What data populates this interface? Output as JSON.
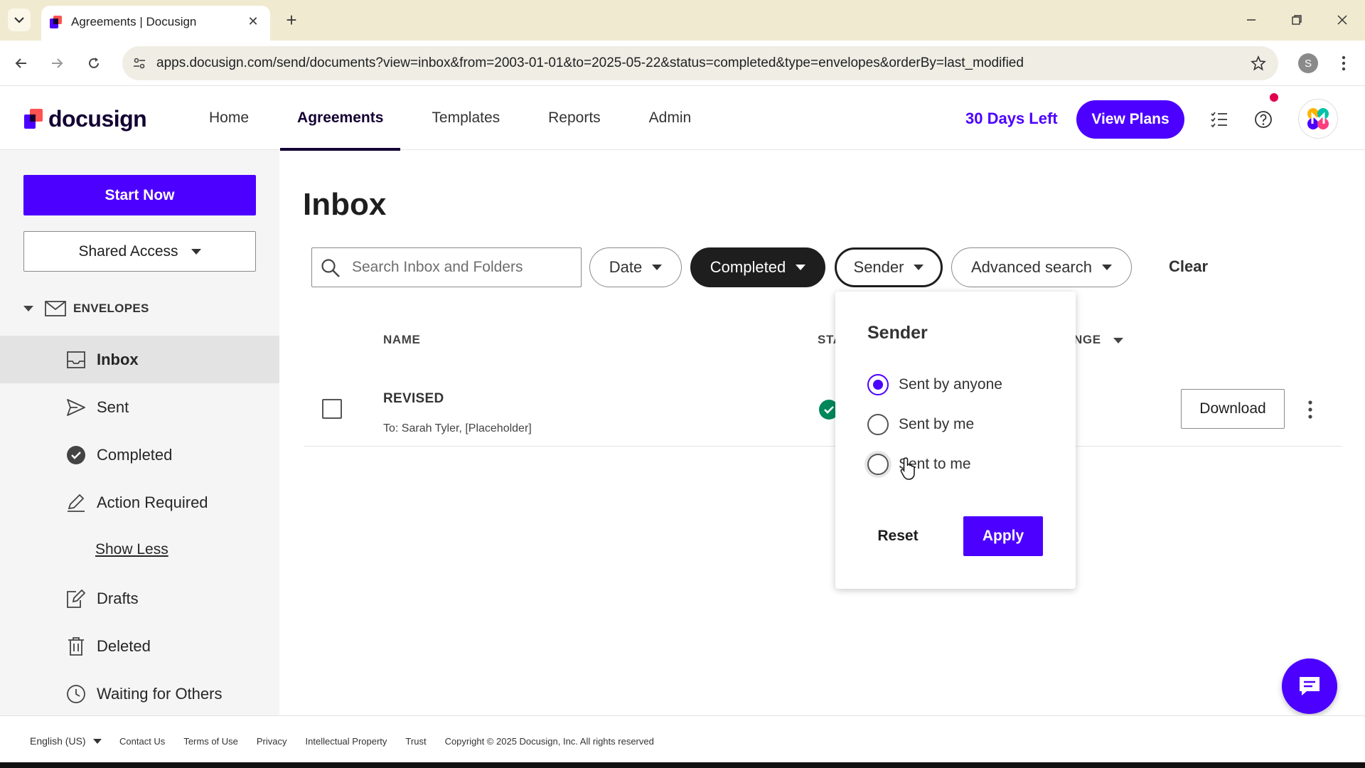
{
  "browser": {
    "tab_title": "Agreements | Docusign",
    "url": "apps.docusign.com/send/documents?view=inbox&from=2003-01-01&to=2025-05-22&status=completed&type=envelopes&orderBy=last_modified",
    "profile_initial": "S"
  },
  "header": {
    "logo_text": "docusign",
    "nav": [
      {
        "label": "Home"
      },
      {
        "label": "Agreements",
        "active": true
      },
      {
        "label": "Templates"
      },
      {
        "label": "Reports"
      },
      {
        "label": "Admin"
      }
    ],
    "trial": "30 Days Left",
    "view_plans": "View Plans"
  },
  "sidebar": {
    "start_now": "Start Now",
    "shared_access": "Shared Access",
    "envelopes_label": "ENVELOPES",
    "items": [
      {
        "label": "Inbox",
        "icon": "inbox-icon",
        "active": true
      },
      {
        "label": "Sent",
        "icon": "send-icon"
      },
      {
        "label": "Completed",
        "icon": "check-circle-icon"
      },
      {
        "label": "Action Required",
        "icon": "pen-icon"
      },
      {
        "label": "Drafts",
        "icon": "draft-icon"
      },
      {
        "label": "Deleted",
        "icon": "trash-icon"
      },
      {
        "label": "Waiting for Others",
        "icon": "clock-icon"
      }
    ],
    "show_less": "Show Less"
  },
  "main": {
    "title": "Inbox",
    "search_placeholder": "Search Inbox and Folders",
    "filters": {
      "date": "Date",
      "status": "Completed",
      "sender": "Sender",
      "advanced": "Advanced search",
      "clear": "Clear"
    },
    "columns": {
      "name": "NAME",
      "status": "STA",
      "last_change": "NGE"
    },
    "rows": [
      {
        "name": "REVISED",
        "to": "To: Sarah Tyler, [Placeholder]",
        "action": "Download"
      }
    ]
  },
  "sender_popover": {
    "title": "Sender",
    "options": [
      {
        "label": "Sent by anyone",
        "checked": true
      },
      {
        "label": "Sent by me",
        "checked": false
      },
      {
        "label": "Sent to me",
        "checked": false
      }
    ],
    "reset": "Reset",
    "apply": "Apply"
  },
  "footer": {
    "language": "English (US)",
    "links": [
      "Contact Us",
      "Terms of Use",
      "Privacy",
      "Intellectual Property",
      "Trust"
    ],
    "copyright": "Copyright © 2025 Docusign, Inc. All rights reserved"
  },
  "colors": {
    "brand_purple": "#4c00ff",
    "brand_dark": "#130032",
    "success_green": "#00875a"
  }
}
